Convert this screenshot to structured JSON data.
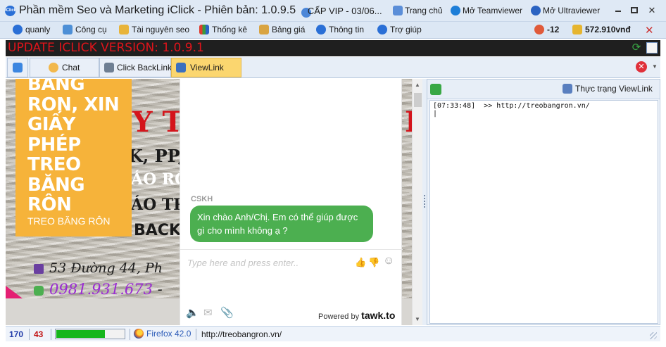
{
  "window": {
    "title": "Phần mềm Seo và Marketing iClick - Phiên bản: 1.0.9.5",
    "app_icon_text": "iClick",
    "vip_text": "CẤP VIP - 03/06...",
    "links": [
      {
        "label": "Trang chủ",
        "icon": "home-page-icon"
      },
      {
        "label": "Mở Teamviewer",
        "icon": "teamviewer-icon"
      },
      {
        "label": "Mở Ultraviewer",
        "icon": "ultraviewer-icon"
      }
    ]
  },
  "menu": {
    "items": [
      {
        "label": "quanly",
        "icon": "user-account-icon"
      },
      {
        "label": "Công cụ",
        "icon": "tools-icon"
      },
      {
        "label": "Tài nguyên seo",
        "icon": "folder-icon"
      },
      {
        "label": "Thống kê",
        "icon": "bar-chart-icon"
      },
      {
        "label": "Bảng giá",
        "icon": "price-table-icon"
      },
      {
        "label": "Thông tin",
        "icon": "info-icon"
      },
      {
        "label": "Trợ giúp",
        "icon": "help-icon"
      }
    ],
    "points": "-12",
    "balance": "572.910vnđ"
  },
  "banner": {
    "text": "UPDATE ICLICK VERSION: 1.0.9.1"
  },
  "tabs": {
    "items": [
      {
        "label": "Chat",
        "icon": "chat-icon"
      },
      {
        "label": "Click BackLink",
        "icon": "mouse-click-icon"
      },
      {
        "label": "ViewLink",
        "icon": "viewlink-monitor-icon",
        "active": true
      }
    ]
  },
  "webpage": {
    "banner_big_text": "BĂNG RON, XIN GIẤY PHÉP TREO BĂNG RÔN",
    "banner_small_text": "TREO BĂNG RÔN",
    "sea_texts": [
      "Y TN",
      "K, PP, I",
      "ÁO RÔN",
      "ÁO TRÊ",
      "BACK"
    ],
    "address": "53 Đường 44, Ph",
    "phone": "0981.931.673",
    "phone_suffix": "-"
  },
  "chat_widget": {
    "agent_name": "CSKH",
    "message": "Xin chào Anh/Chị. Em có thể giúp được gì cho mình không ạ ?",
    "input_placeholder": "Type here and press enter..",
    "powered_by": "Powered by",
    "brand": "tawk.to"
  },
  "log_panel": {
    "status_button": "Thực trạng ViewLink",
    "log_text": "[07:33:48]  >> http://treobangron.vn/\n|"
  },
  "statusbar": {
    "count_blue": "170",
    "count_red": "43",
    "progress_percent": 72,
    "browser": "Firefox 42.0",
    "url": "http://treobangron.vn/"
  },
  "colors": {
    "banner_text": "#e0141b",
    "active_tab": "#fbd66f",
    "chat_bubble": "#4caf50",
    "orange_box": "#f6b33a"
  }
}
